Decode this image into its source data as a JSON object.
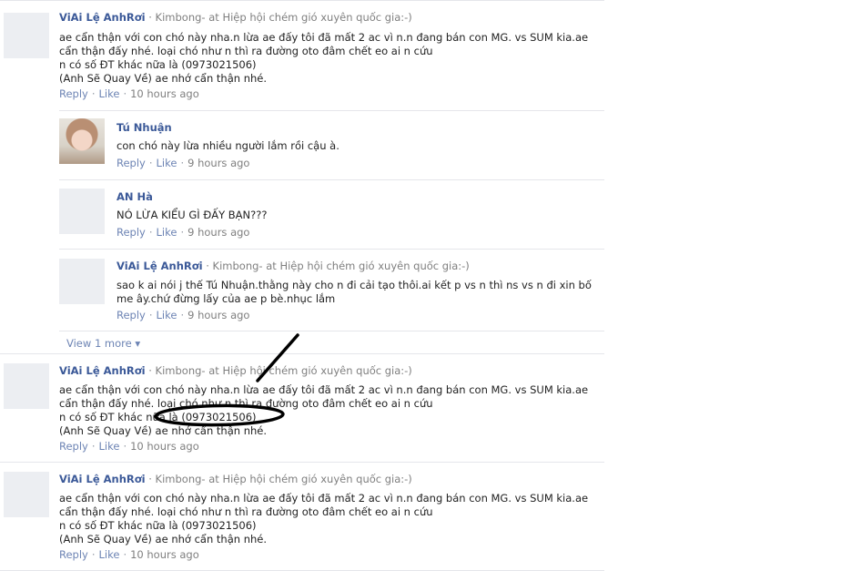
{
  "comments": [
    {
      "author": "ViAi Lệ AnhRơi",
      "meta": "· Kimbong- at Hiệp hội chém gió xuyên quốc gia:-)",
      "lines": [
        "ae cẩn thận với con chó này nha.n lừa ae đấy tôi đã mất 2 ac vì n.n đang bán con MG. vs SUM kia.ae",
        "cẩn thận đấy nhé. loại chó như n thì ra đường oto đâm chết eo ai n cứu",
        "n có số ĐT khác nữa là (0973021506)",
        "(Anh Sẽ Quay Về) ae nhớ cẩn thận nhé."
      ],
      "reply": "Reply",
      "like": "Like",
      "time": "10 hours ago"
    },
    {
      "author": "ViAi Lệ AnhRơi",
      "meta": "· Kimbong- at Hiệp hội chém gió xuyên quốc gia:-)",
      "lines": [
        "ae cẩn thận với con chó này nha.n lừa ae đấy tôi đã mất 2 ac vì n.n đang bán con MG. vs SUM kia.ae",
        "cẩn thận đấy nhé. loại chó như n thì ra đường oto đâm chết eo ai n cứu",
        "n có số ĐT khác nữa là (0973021506)",
        "(Anh Sẽ Quay Về) ae nhớ cẩn thận nhé."
      ],
      "reply": "Reply",
      "like": "Like",
      "time": "10 hours ago"
    },
    {
      "author": "ViAi Lệ AnhRơi",
      "meta": "· Kimbong- at Hiệp hội chém gió xuyên quốc gia:-)",
      "lines": [
        "ae cẩn thận với con chó này nha.n lừa ae đấy tôi đã mất 2 ac vì n.n đang bán con MG. vs SUM kia.ae",
        "cẩn thận đấy nhé. loại chó như n thì ra đường oto đâm chết eo ai n cứu",
        "n có số ĐT khác nữa là (0973021506)",
        "(Anh Sẽ Quay Về) ae nhớ cẩn thận nhé."
      ],
      "reply": "Reply",
      "like": "Like",
      "time": "10 hours ago"
    }
  ],
  "replies": [
    {
      "author": "Tú Nhuận",
      "meta": "",
      "lines": [
        "con chó này lừa nhiều người lắm rồi cậu à."
      ],
      "reply": "Reply",
      "like": "Like",
      "time": "9 hours ago"
    },
    {
      "author": "AN Hà",
      "meta": "",
      "lines": [
        "NÓ LỪA KIỂU GÌ ĐẤY BẠN???"
      ],
      "reply": "Reply",
      "like": "Like",
      "time": "9 hours ago"
    },
    {
      "author": "ViAi Lệ AnhRơi",
      "meta": "· Kimbong- at Hiệp hội chém gió xuyên quốc gia:-)",
      "lines": [
        "sao k ai nói j thế Tú Nhuận.thằng này cho n đi cải tạo thôi.ai kết p vs n thì ns vs n đi xin bố",
        "me ây.chứ đừng lấy của ae p bè.nhục lắm"
      ],
      "reply": "Reply",
      "like": "Like",
      "time": "9 hours ago"
    }
  ],
  "view_more": "View 1 more ▾",
  "separator": "·",
  "colors": {
    "link": "#6d84b4",
    "author": "#3b5998",
    "annotation": "#000000"
  }
}
